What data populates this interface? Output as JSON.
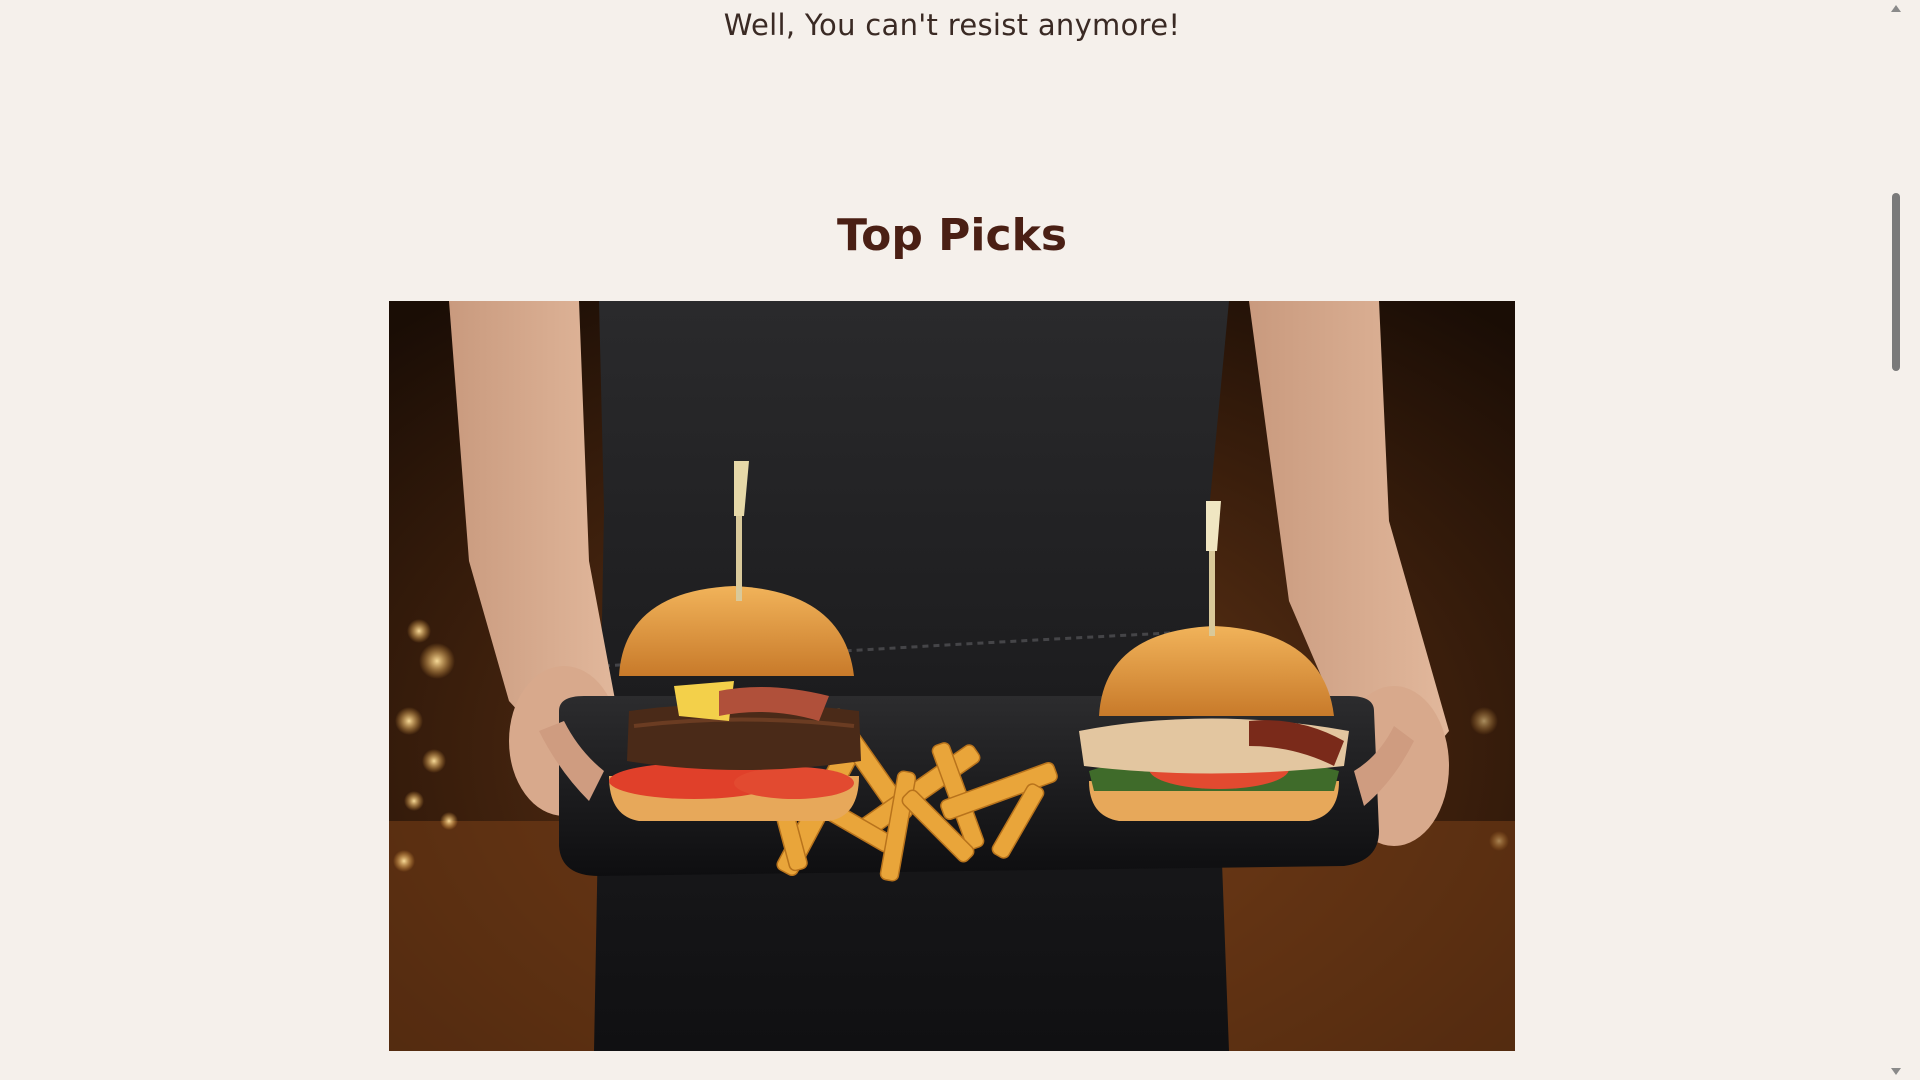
{
  "hero": {
    "tagline": "Well, You can't resist anymore!"
  },
  "top_picks": {
    "title": "Top Picks",
    "photo_subject": "Server in dark denim apron holding a tray with two burgers and french fries"
  },
  "scrollbar": {
    "position_fraction": 0.12
  },
  "colors": {
    "background": "#f5f0eb",
    "title": "#4a1f14",
    "text": "#3a2a24"
  }
}
